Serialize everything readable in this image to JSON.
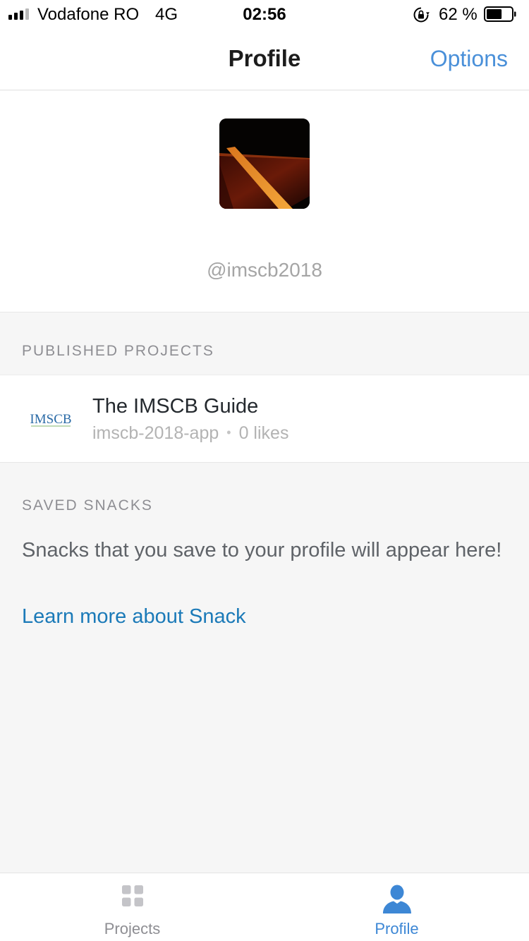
{
  "status_bar": {
    "carrier": "Vodafone RO",
    "network": "4G",
    "time": "02:56",
    "battery_percent": "62 %",
    "battery_level": 0.62,
    "signal_bars_filled": 3,
    "signal_bars_total": 4,
    "icons": [
      "signal-icon",
      "rotation-lock-icon",
      "battery-icon"
    ]
  },
  "nav": {
    "title": "Profile",
    "options_label": "Options"
  },
  "profile": {
    "username": "@imscb2018",
    "avatar_icon": "road-photo-avatar"
  },
  "published": {
    "header": "PUBLISHED PROJECTS",
    "projects": [
      {
        "name": "The IMSCB Guide",
        "slug": "imscb-2018-app",
        "separator": "•",
        "likes": "0 likes",
        "logo_text": "IMSCB"
      }
    ]
  },
  "saved": {
    "header": "SAVED SNACKS",
    "empty_text": "Snacks that you save to your profile will appear here!",
    "learn_more": "Learn more about Snack"
  },
  "tabs": [
    {
      "label": "Projects",
      "icon": "grid-icon",
      "active": false
    },
    {
      "label": "Profile",
      "icon": "person-icon",
      "active": true
    }
  ],
  "colors": {
    "accent": "#4a90d9",
    "link": "#1b7ab8",
    "active_tab": "#3d87d5",
    "muted": "#8e8e93",
    "background": "#f6f6f6"
  }
}
